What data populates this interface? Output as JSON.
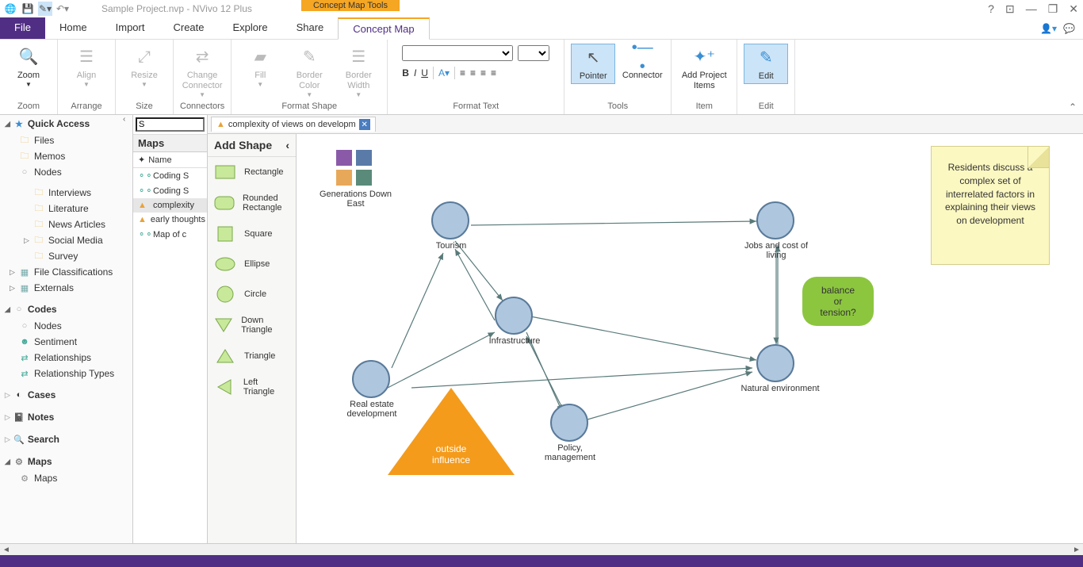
{
  "title": "Sample Project.nvp - NVivo 12 Plus",
  "contextual_tab": "Concept Map Tools",
  "menubar": {
    "file": "File",
    "tabs": [
      "Home",
      "Import",
      "Create",
      "Explore",
      "Share",
      "Concept Map"
    ]
  },
  "ribbon": {
    "zoom": {
      "btn": "Zoom",
      "label": "Zoom"
    },
    "arrange": {
      "btn": "Align",
      "resize": "Resize",
      "label": "Arrange"
    },
    "size": {
      "label": "Size"
    },
    "connectors": {
      "btn": "Change Connector",
      "label": "Connectors"
    },
    "formatshape": {
      "fill": "Fill",
      "bcolor": "Border Color",
      "bwidth": "Border Width",
      "label": "Format Shape"
    },
    "formattext": {
      "label": "Format Text"
    },
    "tools": {
      "pointer": "Pointer",
      "connector": "Connector",
      "label": "Tools"
    },
    "item": {
      "addproj": "Add Project Items",
      "label": "Item"
    },
    "edit": {
      "btn": "Edit",
      "label": "Edit"
    }
  },
  "nav": {
    "quick_access": "Quick Access",
    "qa_items": [
      "Files",
      "Memos",
      "Nodes"
    ],
    "data_items": [
      "Interviews",
      "Literature",
      "News Articles",
      "Social Media",
      "Survey"
    ],
    "fc": "File Classifications",
    "ext": "Externals",
    "codes": "Codes",
    "codes_items": [
      "Nodes",
      "Sentiment",
      "Relationships",
      "Relationship Types"
    ],
    "cases": "Cases",
    "notes": "Notes",
    "search": "Search",
    "maps": "Maps",
    "maps_item": "Maps"
  },
  "listpane": {
    "search_val": "S",
    "header": "Maps",
    "col": "Name",
    "rows": [
      "Coding S",
      "Coding S",
      "complexity",
      "early thoughts",
      "Map of c"
    ]
  },
  "doctab": "complexity of views on developm",
  "shapes_panel": {
    "header": "Add Shape",
    "shapes": [
      "Rectangle",
      "Rounded Rectangle",
      "Square",
      "Ellipse",
      "Circle",
      "Down Triangle",
      "Triangle",
      "Left Triangle"
    ]
  },
  "canvas": {
    "legend_label": "Generations Down East",
    "nodes": {
      "tourism": "Tourism",
      "jobs": "Jobs and cost of living",
      "infra": "Infrastructure",
      "realestate": "Real estate development",
      "policy": "Policy, management",
      "env": "Natural environment"
    },
    "bubble": "balance or tension?",
    "triangle": "outside influence",
    "sticky": "Residents discuss a complex set of interrelated factors in explaining their views on development"
  }
}
